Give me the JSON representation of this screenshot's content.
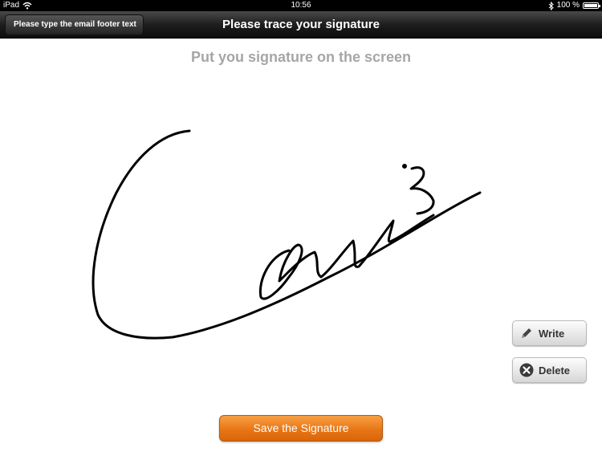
{
  "status_bar": {
    "device": "iPad",
    "time": "10:56",
    "battery": "100 %",
    "battery_level": 1.0
  },
  "nav_bar": {
    "back_label": "Please type the email footer text",
    "title": "Please trace your signature"
  },
  "main": {
    "instruction": "Put you signature on the screen"
  },
  "actions": {
    "write_label": "Write",
    "delete_label": "Delete",
    "save_label": "Save the Signature"
  },
  "colors": {
    "save_accent": "#e87617",
    "instruction_text": "#a6a6a6",
    "ink": "#000000"
  },
  "icons": [
    "wifi-icon",
    "bluetooth-icon",
    "battery-icon",
    "pencil-icon",
    "delete-x-icon"
  ]
}
